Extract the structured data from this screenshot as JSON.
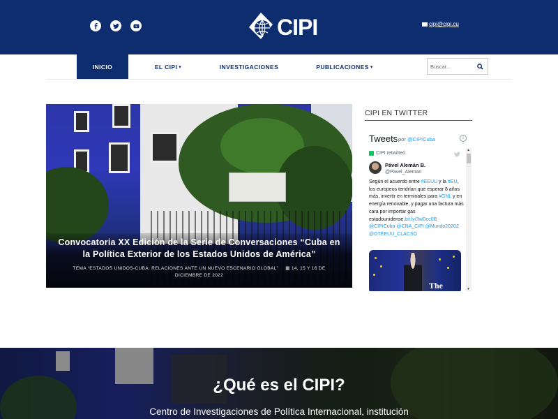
{
  "header": {
    "logo_text": "CIPI",
    "email": "cipi@cipi.cu",
    "social": [
      "facebook-icon",
      "twitter-icon",
      "youtube-icon"
    ],
    "colors": {
      "primary": "#0d2d6e",
      "link": "#1d9bf0"
    }
  },
  "nav": {
    "items": [
      {
        "label": "INICIO",
        "active": true
      },
      {
        "label": "EL CIPI",
        "caret": "▾"
      },
      {
        "label": "INVESTIGACIONES"
      },
      {
        "label": "PUBLICACIONES",
        "caret": "▾"
      }
    ],
    "search_placeholder": "Buscar..."
  },
  "hero": {
    "title": "Convocatoria XX Edición de la Serie de Conversaciones “Cuba en la Política Exterior de los Estados Unidos de América”",
    "topic": "TEMA “ESTADOS UNIDOS-CUBA: RELACIONES ANTE UN NUEVO ESCENARIO GLOBAL”",
    "date": "14, 15 Y 16 DE DICIEMBRE DE 2022"
  },
  "twitter": {
    "section_heading": "CIPI EN TWITTER",
    "widget_title": "Tweets",
    "by_label": "por",
    "by_handle": "@CIPICuba",
    "retweet_label": "CIPI retwitteó",
    "tweet": {
      "author_name": "Pável Alemán B.",
      "author_handle": "@Pavel_Aleman",
      "text_1": "Según el acuerdo entre",
      "tag_eeuu": "#EEUU",
      "text_2": "y la",
      "tag_eu": "#EU",
      "text_3": ", los europeos tendrían que esperar 8 años más, invertir en terminales para",
      "tag_gnl": "#GNL",
      "text_4": "y en energía renovable, y pagar una factura más cara por importar gas estadounidense.",
      "link": "bit.ly/3wDcc0B",
      "mentions": "@CIPICuba @CNA_CIPI @Mundo20202 @GTEEUU_CLACSO",
      "image_caption": "The"
    }
  },
  "about": {
    "title": "¿Qué es el CIPI?",
    "description": "Centro de Investigaciones de Política Internacional, institución"
  }
}
